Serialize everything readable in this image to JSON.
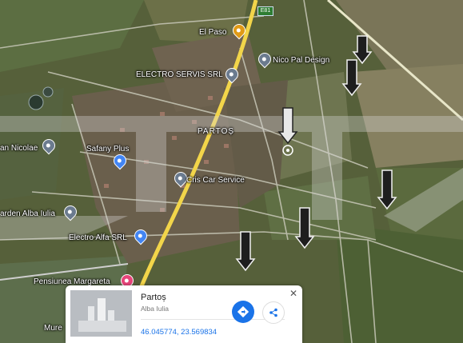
{
  "map": {
    "area_name": "PARTOȘ",
    "road_shield": "E81",
    "places": [
      {
        "name": "El Paso",
        "icon": "restaurant-pin-icon",
        "color": "#e09a16"
      },
      {
        "name": "Nico Pal Design",
        "icon": "place-pin-icon",
        "color": "#6b7b8f"
      },
      {
        "name": "ELECTRO SERVIS SRL",
        "icon": "place-pin-icon",
        "color": "#6b7b8f"
      },
      {
        "name": "Safany Plus",
        "icon": "shopping-pin-icon",
        "color": "#4285f4"
      },
      {
        "name": "Cris Car Service",
        "icon": "place-pin-icon",
        "color": "#6b7b8f"
      },
      {
        "name": "an Nicolae",
        "icon": "place-pin-icon",
        "color": "#6b7b8f"
      },
      {
        "name": "arden Alba Iulia",
        "icon": "place-pin-icon",
        "color": "#6b7b8f"
      },
      {
        "name": "Electro Alfa SRL",
        "icon": "shopping-pin-icon",
        "color": "#4285f4"
      },
      {
        "name": "Pensiunea Margareta",
        "icon": "hotel-pin-icon",
        "color": "#e8457a"
      },
      {
        "name": "Mure",
        "icon": "",
        "color": ""
      }
    ],
    "annotation_arrow_count": 6,
    "watermark_color": "#d9d9d9"
  },
  "info_card": {
    "title": "Partoș",
    "subtitle": "Alba Iulia",
    "coordinates": "46.045774, 23.569834",
    "directions_icon": "directions-icon",
    "share_icon": "share-icon",
    "close_icon": "close-icon",
    "accent_color": "#1a73e8"
  }
}
